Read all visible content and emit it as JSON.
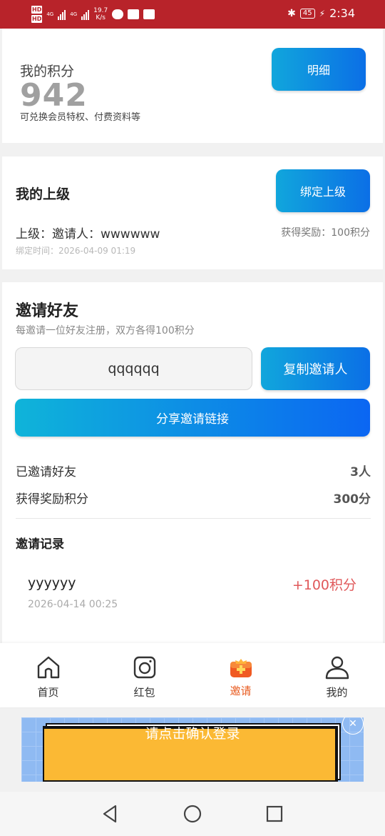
{
  "status_bar": {
    "hd1": "HD",
    "hd2": "HD",
    "net1": "4G",
    "net2": "4G",
    "speed_value": "19.7",
    "speed_unit": "K/s",
    "battery": "45",
    "time": "2:34"
  },
  "points_card": {
    "label": "我的积分",
    "value": "942",
    "description": "可兑换会员特权、付费资料等",
    "detail_button": "明细"
  },
  "superior_card": {
    "title": "我的上级",
    "bind_button": "绑定上级",
    "inviter": "上级：邀请人：wwwwww",
    "reward": "获得奖励：100积分",
    "bind_time": "绑定时间：2026-04-09 01:19"
  },
  "invite_card": {
    "title": "邀请好友",
    "subtitle": "每邀请一位好友注册，双方各得100积分",
    "code": "qqqqqq",
    "copy_button": "复制邀请人",
    "share_button": "分享邀请链接",
    "stats": [
      {
        "label": "已邀请好友",
        "value": "3人"
      },
      {
        "label": "获得奖励积分",
        "value": "300分"
      }
    ],
    "records_title": "邀请记录",
    "records": [
      {
        "name": "yyyyyy",
        "time": "2026-04-14 00:25",
        "points": "+100积分"
      }
    ]
  },
  "tab_bar": {
    "tabs": [
      {
        "label": "首页",
        "icon": "home-icon",
        "active": false
      },
      {
        "label": "红包",
        "icon": "camera-icon",
        "active": false
      },
      {
        "label": "邀请",
        "icon": "gift-icon",
        "active": true
      },
      {
        "label": "我的",
        "icon": "person-icon",
        "active": false
      }
    ]
  },
  "ad": {
    "text": "请点击确认登录"
  },
  "colors": {
    "status_bar": "#b8232a",
    "accent_blue": "#0b6fe6",
    "active_tab": "#e85a1e",
    "reward_red": "#e0585a"
  }
}
